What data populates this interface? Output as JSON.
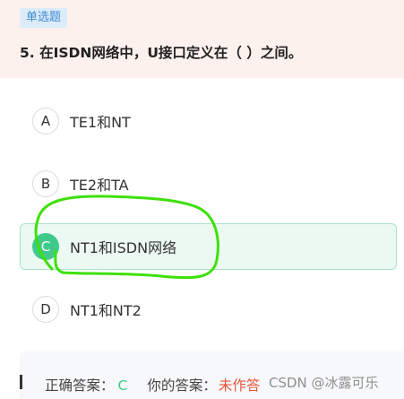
{
  "question": {
    "type_badge": "单选题",
    "text": "5. 在ISDN网络中，U接口定义在（ ）之间。"
  },
  "options": [
    {
      "letter": "A",
      "text": "TE1和NT",
      "selected": false
    },
    {
      "letter": "B",
      "text": "TE2和TA",
      "selected": false
    },
    {
      "letter": "C",
      "text": "NT1和ISDN网络",
      "selected": true
    },
    {
      "letter": "D",
      "text": "NT1和NT2",
      "selected": false
    }
  ],
  "answer": {
    "correct_label": "正确答案：",
    "correct_value": "C",
    "your_label": "你的答案：",
    "your_value": "未作答"
  },
  "watermark": "CSDN @冰露可乐",
  "colors": {
    "header_bg": "#fdf1ee",
    "badge_bg": "#dcebf8",
    "badge_text": "#3d8bd6",
    "accent_green": "#3fc98c",
    "wrong_red": "#e8553b",
    "annotation_green": "#3ee00a"
  }
}
